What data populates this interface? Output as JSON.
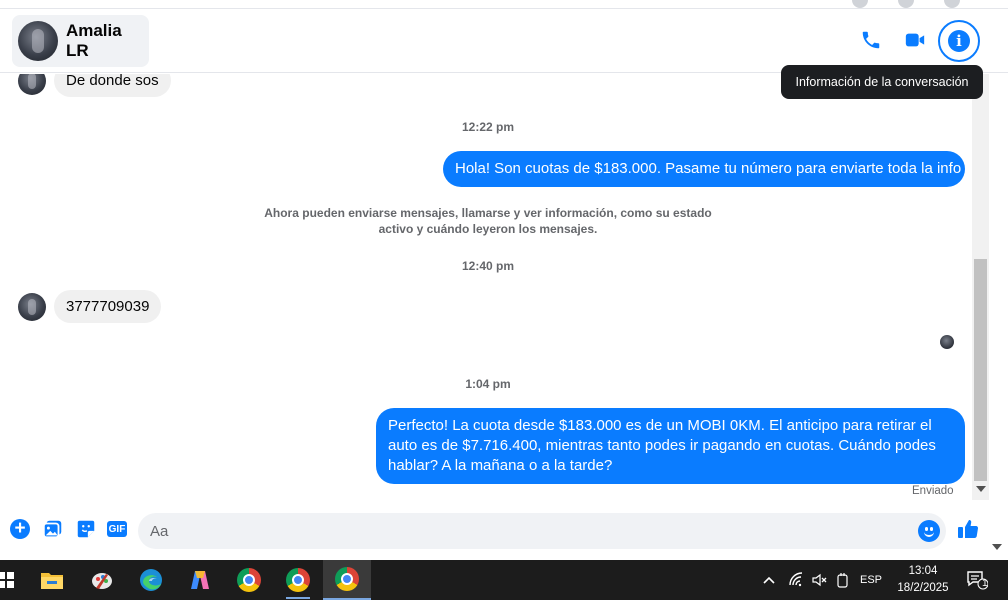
{
  "header": {
    "contact_name": "Amalia LR",
    "tooltip": "Información de la conversación"
  },
  "thread": {
    "messages": [
      {
        "type": "in",
        "text": "De donde sos"
      },
      {
        "type": "timestamp",
        "text": "12:22 pm"
      },
      {
        "type": "out",
        "text": "Hola! Son cuotas de $183.000. Pasame tu número para enviarte toda la info"
      },
      {
        "type": "system",
        "line1": "Ahora pueden enviarse mensajes, llamarse y ver información, como su estado",
        "line2": "activo y cuándo leyeron los mensajes."
      },
      {
        "type": "timestamp",
        "text": "12:40 pm"
      },
      {
        "type": "in",
        "text": "3777709039"
      },
      {
        "type": "timestamp",
        "text": "1:04 pm"
      },
      {
        "type": "out",
        "text": "Perfecto! La cuota desde $183.000 es de un MOBI 0KM. El anticipo para retirar el auto es de $7.716.400, mientras tanto podes ir pagando en cuotas. Cuándo podes hablar? A la mañana o a la tarde?"
      }
    ],
    "status": "Enviado"
  },
  "composer": {
    "placeholder": "Aa",
    "value": ""
  },
  "taskbar": {
    "language": "ESP",
    "time": "13:04",
    "date": "18/2/2025",
    "notifications": "1"
  },
  "colors": {
    "accent": "#0a7cff",
    "incoming_bubble": "#f0f0f0",
    "taskbar": "#1c1c1c"
  },
  "icons": [
    "phone-icon",
    "video-icon",
    "info-icon",
    "plus-icon",
    "photo-icon",
    "sticker-icon",
    "gif-icon",
    "emoji-icon",
    "like-icon",
    "start-icon",
    "file-explorer-icon",
    "edge-icon",
    "copilot-icon",
    "chrome-icon",
    "wifi-icon",
    "volume-muted-icon",
    "notifications-icon"
  ]
}
